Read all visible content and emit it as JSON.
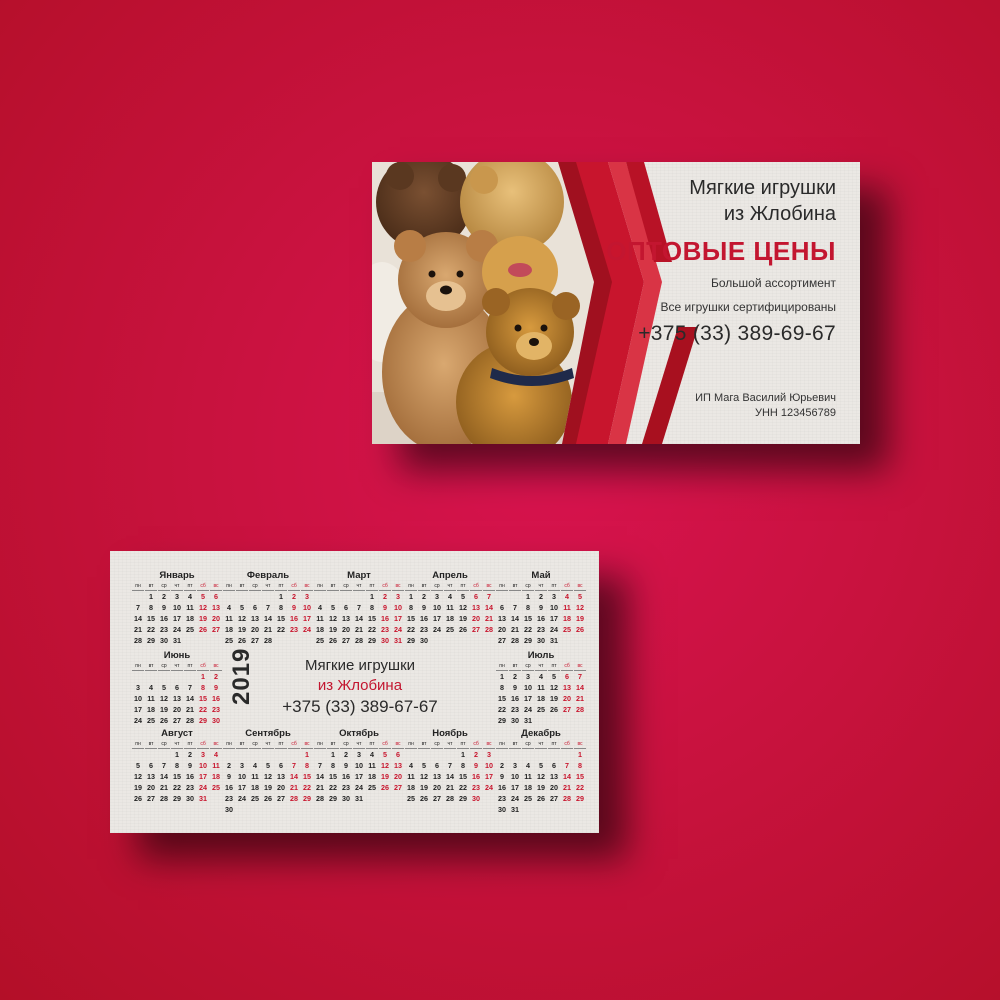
{
  "front": {
    "title_line1": "Мягкие игрушки",
    "title_line2": "из Жлобина",
    "headline": "ОПТОВЫЕ ЦЕНЫ",
    "line_assortment": "Большой ассортимент",
    "line_certified": "Все игрушки сертифицированы",
    "phone": "+375 (33) 389-69-67",
    "owner": "ИП Мага Василий Юрьевич",
    "unn": "УНН 123456789"
  },
  "back": {
    "year": "2019",
    "title_line1": "Мягкие игрушки",
    "title_line2": "из Жлобина",
    "phone": "+375 (33) 389-67-67",
    "weekdays": [
      "пн",
      "вт",
      "ср",
      "чт",
      "пт",
      "сб",
      "вс"
    ],
    "months": [
      {
        "name": "Январь",
        "start": 1,
        "days": 31
      },
      {
        "name": "Февраль",
        "start": 4,
        "days": 28
      },
      {
        "name": "Март",
        "start": 4,
        "days": 31
      },
      {
        "name": "Апрель",
        "start": 0,
        "days": 30
      },
      {
        "name": "Май",
        "start": 2,
        "days": 31
      },
      {
        "name": "Июнь",
        "start": 5,
        "days": 30
      },
      {
        "name": "Июль",
        "start": 0,
        "days": 31
      },
      {
        "name": "Август",
        "start": 3,
        "days": 31
      },
      {
        "name": "Сентябрь",
        "start": 6,
        "days": 30
      },
      {
        "name": "Октябрь",
        "start": 1,
        "days": 31
      },
      {
        "name": "Ноябрь",
        "start": 4,
        "days": 30
      },
      {
        "name": "Декабрь",
        "start": 6,
        "days": 31
      }
    ]
  },
  "colors": {
    "background": "#c8123e",
    "accent_red": "#c31630",
    "paper": "#ebe8e4"
  }
}
